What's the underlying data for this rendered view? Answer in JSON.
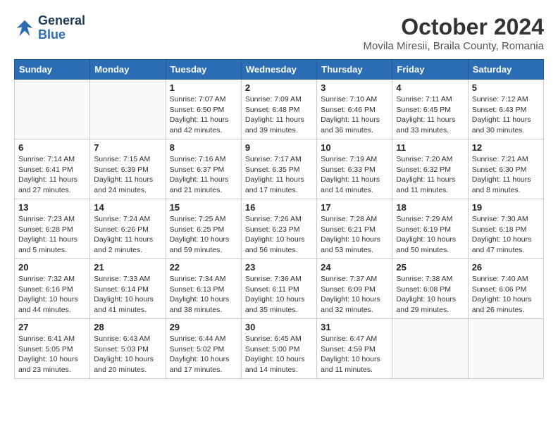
{
  "header": {
    "logo_line1": "General",
    "logo_line2": "Blue",
    "month": "October 2024",
    "location": "Movila Miresii, Braila County, Romania"
  },
  "days_of_week": [
    "Sunday",
    "Monday",
    "Tuesday",
    "Wednesday",
    "Thursday",
    "Friday",
    "Saturday"
  ],
  "weeks": [
    [
      {
        "day": "",
        "content": ""
      },
      {
        "day": "",
        "content": ""
      },
      {
        "day": "1",
        "content": "Sunrise: 7:07 AM\nSunset: 6:50 PM\nDaylight: 11 hours and 42 minutes."
      },
      {
        "day": "2",
        "content": "Sunrise: 7:09 AM\nSunset: 6:48 PM\nDaylight: 11 hours and 39 minutes."
      },
      {
        "day": "3",
        "content": "Sunrise: 7:10 AM\nSunset: 6:46 PM\nDaylight: 11 hours and 36 minutes."
      },
      {
        "day": "4",
        "content": "Sunrise: 7:11 AM\nSunset: 6:45 PM\nDaylight: 11 hours and 33 minutes."
      },
      {
        "day": "5",
        "content": "Sunrise: 7:12 AM\nSunset: 6:43 PM\nDaylight: 11 hours and 30 minutes."
      }
    ],
    [
      {
        "day": "6",
        "content": "Sunrise: 7:14 AM\nSunset: 6:41 PM\nDaylight: 11 hours and 27 minutes."
      },
      {
        "day": "7",
        "content": "Sunrise: 7:15 AM\nSunset: 6:39 PM\nDaylight: 11 hours and 24 minutes."
      },
      {
        "day": "8",
        "content": "Sunrise: 7:16 AM\nSunset: 6:37 PM\nDaylight: 11 hours and 21 minutes."
      },
      {
        "day": "9",
        "content": "Sunrise: 7:17 AM\nSunset: 6:35 PM\nDaylight: 11 hours and 17 minutes."
      },
      {
        "day": "10",
        "content": "Sunrise: 7:19 AM\nSunset: 6:33 PM\nDaylight: 11 hours and 14 minutes."
      },
      {
        "day": "11",
        "content": "Sunrise: 7:20 AM\nSunset: 6:32 PM\nDaylight: 11 hours and 11 minutes."
      },
      {
        "day": "12",
        "content": "Sunrise: 7:21 AM\nSunset: 6:30 PM\nDaylight: 11 hours and 8 minutes."
      }
    ],
    [
      {
        "day": "13",
        "content": "Sunrise: 7:23 AM\nSunset: 6:28 PM\nDaylight: 11 hours and 5 minutes."
      },
      {
        "day": "14",
        "content": "Sunrise: 7:24 AM\nSunset: 6:26 PM\nDaylight: 11 hours and 2 minutes."
      },
      {
        "day": "15",
        "content": "Sunrise: 7:25 AM\nSunset: 6:25 PM\nDaylight: 10 hours and 59 minutes."
      },
      {
        "day": "16",
        "content": "Sunrise: 7:26 AM\nSunset: 6:23 PM\nDaylight: 10 hours and 56 minutes."
      },
      {
        "day": "17",
        "content": "Sunrise: 7:28 AM\nSunset: 6:21 PM\nDaylight: 10 hours and 53 minutes."
      },
      {
        "day": "18",
        "content": "Sunrise: 7:29 AM\nSunset: 6:19 PM\nDaylight: 10 hours and 50 minutes."
      },
      {
        "day": "19",
        "content": "Sunrise: 7:30 AM\nSunset: 6:18 PM\nDaylight: 10 hours and 47 minutes."
      }
    ],
    [
      {
        "day": "20",
        "content": "Sunrise: 7:32 AM\nSunset: 6:16 PM\nDaylight: 10 hours and 44 minutes."
      },
      {
        "day": "21",
        "content": "Sunrise: 7:33 AM\nSunset: 6:14 PM\nDaylight: 10 hours and 41 minutes."
      },
      {
        "day": "22",
        "content": "Sunrise: 7:34 AM\nSunset: 6:13 PM\nDaylight: 10 hours and 38 minutes."
      },
      {
        "day": "23",
        "content": "Sunrise: 7:36 AM\nSunset: 6:11 PM\nDaylight: 10 hours and 35 minutes."
      },
      {
        "day": "24",
        "content": "Sunrise: 7:37 AM\nSunset: 6:09 PM\nDaylight: 10 hours and 32 minutes."
      },
      {
        "day": "25",
        "content": "Sunrise: 7:38 AM\nSunset: 6:08 PM\nDaylight: 10 hours and 29 minutes."
      },
      {
        "day": "26",
        "content": "Sunrise: 7:40 AM\nSunset: 6:06 PM\nDaylight: 10 hours and 26 minutes."
      }
    ],
    [
      {
        "day": "27",
        "content": "Sunrise: 6:41 AM\nSunset: 5:05 PM\nDaylight: 10 hours and 23 minutes."
      },
      {
        "day": "28",
        "content": "Sunrise: 6:43 AM\nSunset: 5:03 PM\nDaylight: 10 hours and 20 minutes."
      },
      {
        "day": "29",
        "content": "Sunrise: 6:44 AM\nSunset: 5:02 PM\nDaylight: 10 hours and 17 minutes."
      },
      {
        "day": "30",
        "content": "Sunrise: 6:45 AM\nSunset: 5:00 PM\nDaylight: 10 hours and 14 minutes."
      },
      {
        "day": "31",
        "content": "Sunrise: 6:47 AM\nSunset: 4:59 PM\nDaylight: 10 hours and 11 minutes."
      },
      {
        "day": "",
        "content": ""
      },
      {
        "day": "",
        "content": ""
      }
    ]
  ]
}
